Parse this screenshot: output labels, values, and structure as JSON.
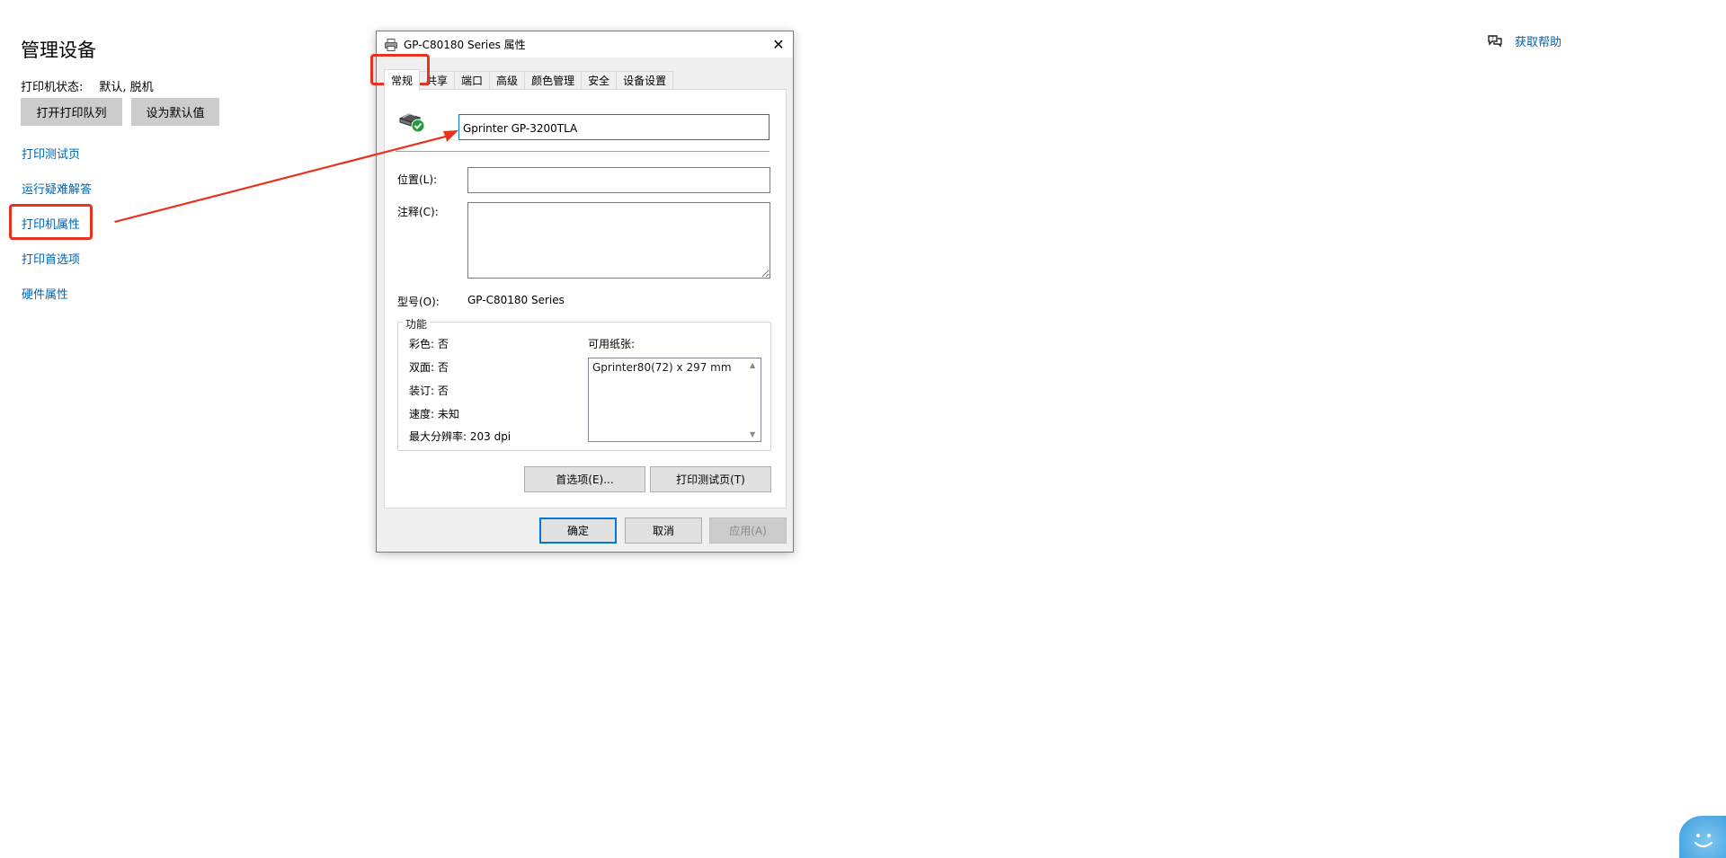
{
  "settings": {
    "title": "管理设备",
    "status_label": "打印机状态:",
    "status_value": "默认, 脱机",
    "open_queue_label": "打开打印队列",
    "set_default_label": "设为默认值",
    "links": [
      "打印测试页",
      "运行疑难解答",
      "打印机属性",
      "打印首选项",
      "硬件属性"
    ],
    "link_color": "#0063b1",
    "help_label": "获取帮助"
  },
  "dialog": {
    "title": "GP-C80180 Series 属性",
    "tabs": [
      "常规",
      "共享",
      "端口",
      "高级",
      "颜色管理",
      "安全",
      "设备设置"
    ],
    "active_tab": "常规",
    "printer_name_value": "Gprinter GP-3200TLA",
    "location_label": "位置(L):",
    "location_value": "",
    "comment_label": "注释(C):",
    "comment_value": "",
    "model_label": "型号(O):",
    "model_value": "GP-C80180 Series",
    "features_title": "功能",
    "features": [
      "彩色: 否",
      "双面: 否",
      "装订: 否",
      "速度: 未知",
      "最大分辨率: 203 dpi"
    ],
    "paper_label": "可用纸张:",
    "paper_items": [
      "Gprinter80(72) x 297 mm"
    ],
    "preferences_button": "首选项(E)...",
    "print_test_button": "打印测试页(T)",
    "ok_button": "确定",
    "cancel_button": "取消",
    "apply_button": "应用(A)"
  },
  "annotation_color": "#e8321e",
  "icons": {
    "printer_title": "printer-icon",
    "printer_status": "printer-ready-icon",
    "help": "help-chat-icon",
    "close": "close-icon"
  }
}
